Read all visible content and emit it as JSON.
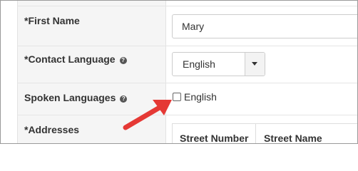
{
  "form": {
    "first_name": {
      "label": "*First Name",
      "value": "Mary"
    },
    "contact_language": {
      "label": "*Contact Language",
      "help_icon": "question-circle-icon",
      "selected": "English"
    },
    "spoken_languages": {
      "label": "Spoken Languages",
      "help_icon": "question-circle-icon",
      "options": [
        {
          "label": "English",
          "checked": false
        }
      ]
    },
    "addresses": {
      "label": "*Addresses",
      "columns": [
        "Street Number",
        "Street Name"
      ]
    }
  },
  "annotation": {
    "icon": "red-arrow-icon",
    "color": "#e53935"
  },
  "colors": {
    "label_column_bg": "#f5f5f5",
    "border": "#cccccc",
    "text": "#333333"
  }
}
